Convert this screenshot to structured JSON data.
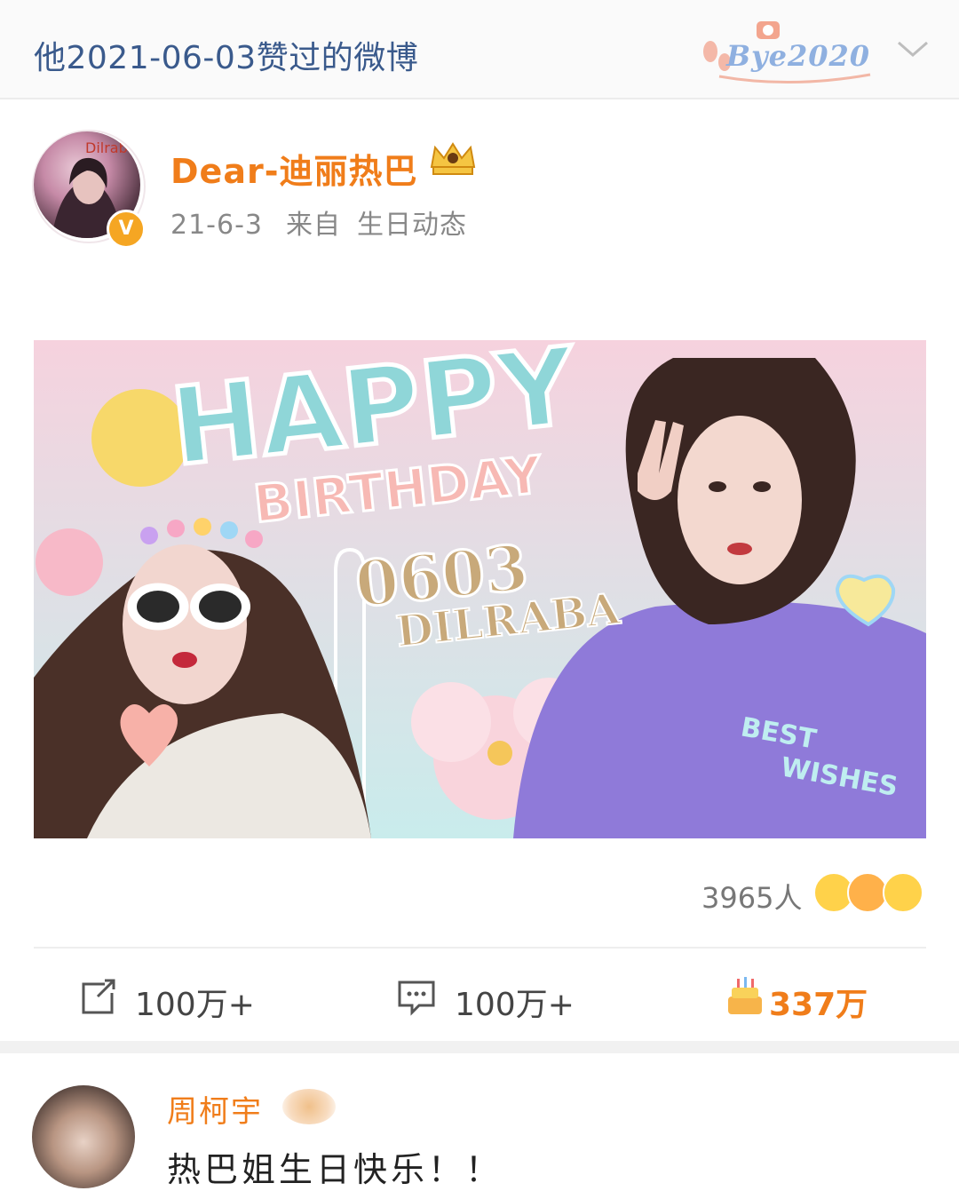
{
  "header": {
    "title": "他2021-06-03赞过的微博",
    "badge_text": "Bye2020"
  },
  "post": {
    "author": "Dear-迪丽热巴",
    "avatar_label": "Dilraba",
    "verified_mark": "V",
    "date": "21-6-3",
    "source_prefix": "来自",
    "source": "生日动态",
    "image": {
      "headline": "HAPPY",
      "subheadline": "BIRTHDAY",
      "date_text": "0603",
      "name_text": "DILRABA",
      "sticker_line1": "BEST",
      "sticker_line2": "WISHES"
    },
    "reactions_count": "3965人",
    "actions": {
      "repost_count": "100万+",
      "comment_count": "100万+",
      "like_count": "337万"
    }
  },
  "comment": {
    "author": "周柯宇",
    "text": "热巴姐生日快乐！！"
  },
  "colors": {
    "accent_orange": "#f07d1a",
    "header_blue": "#3a5a8c",
    "meta_gray": "#888888"
  }
}
